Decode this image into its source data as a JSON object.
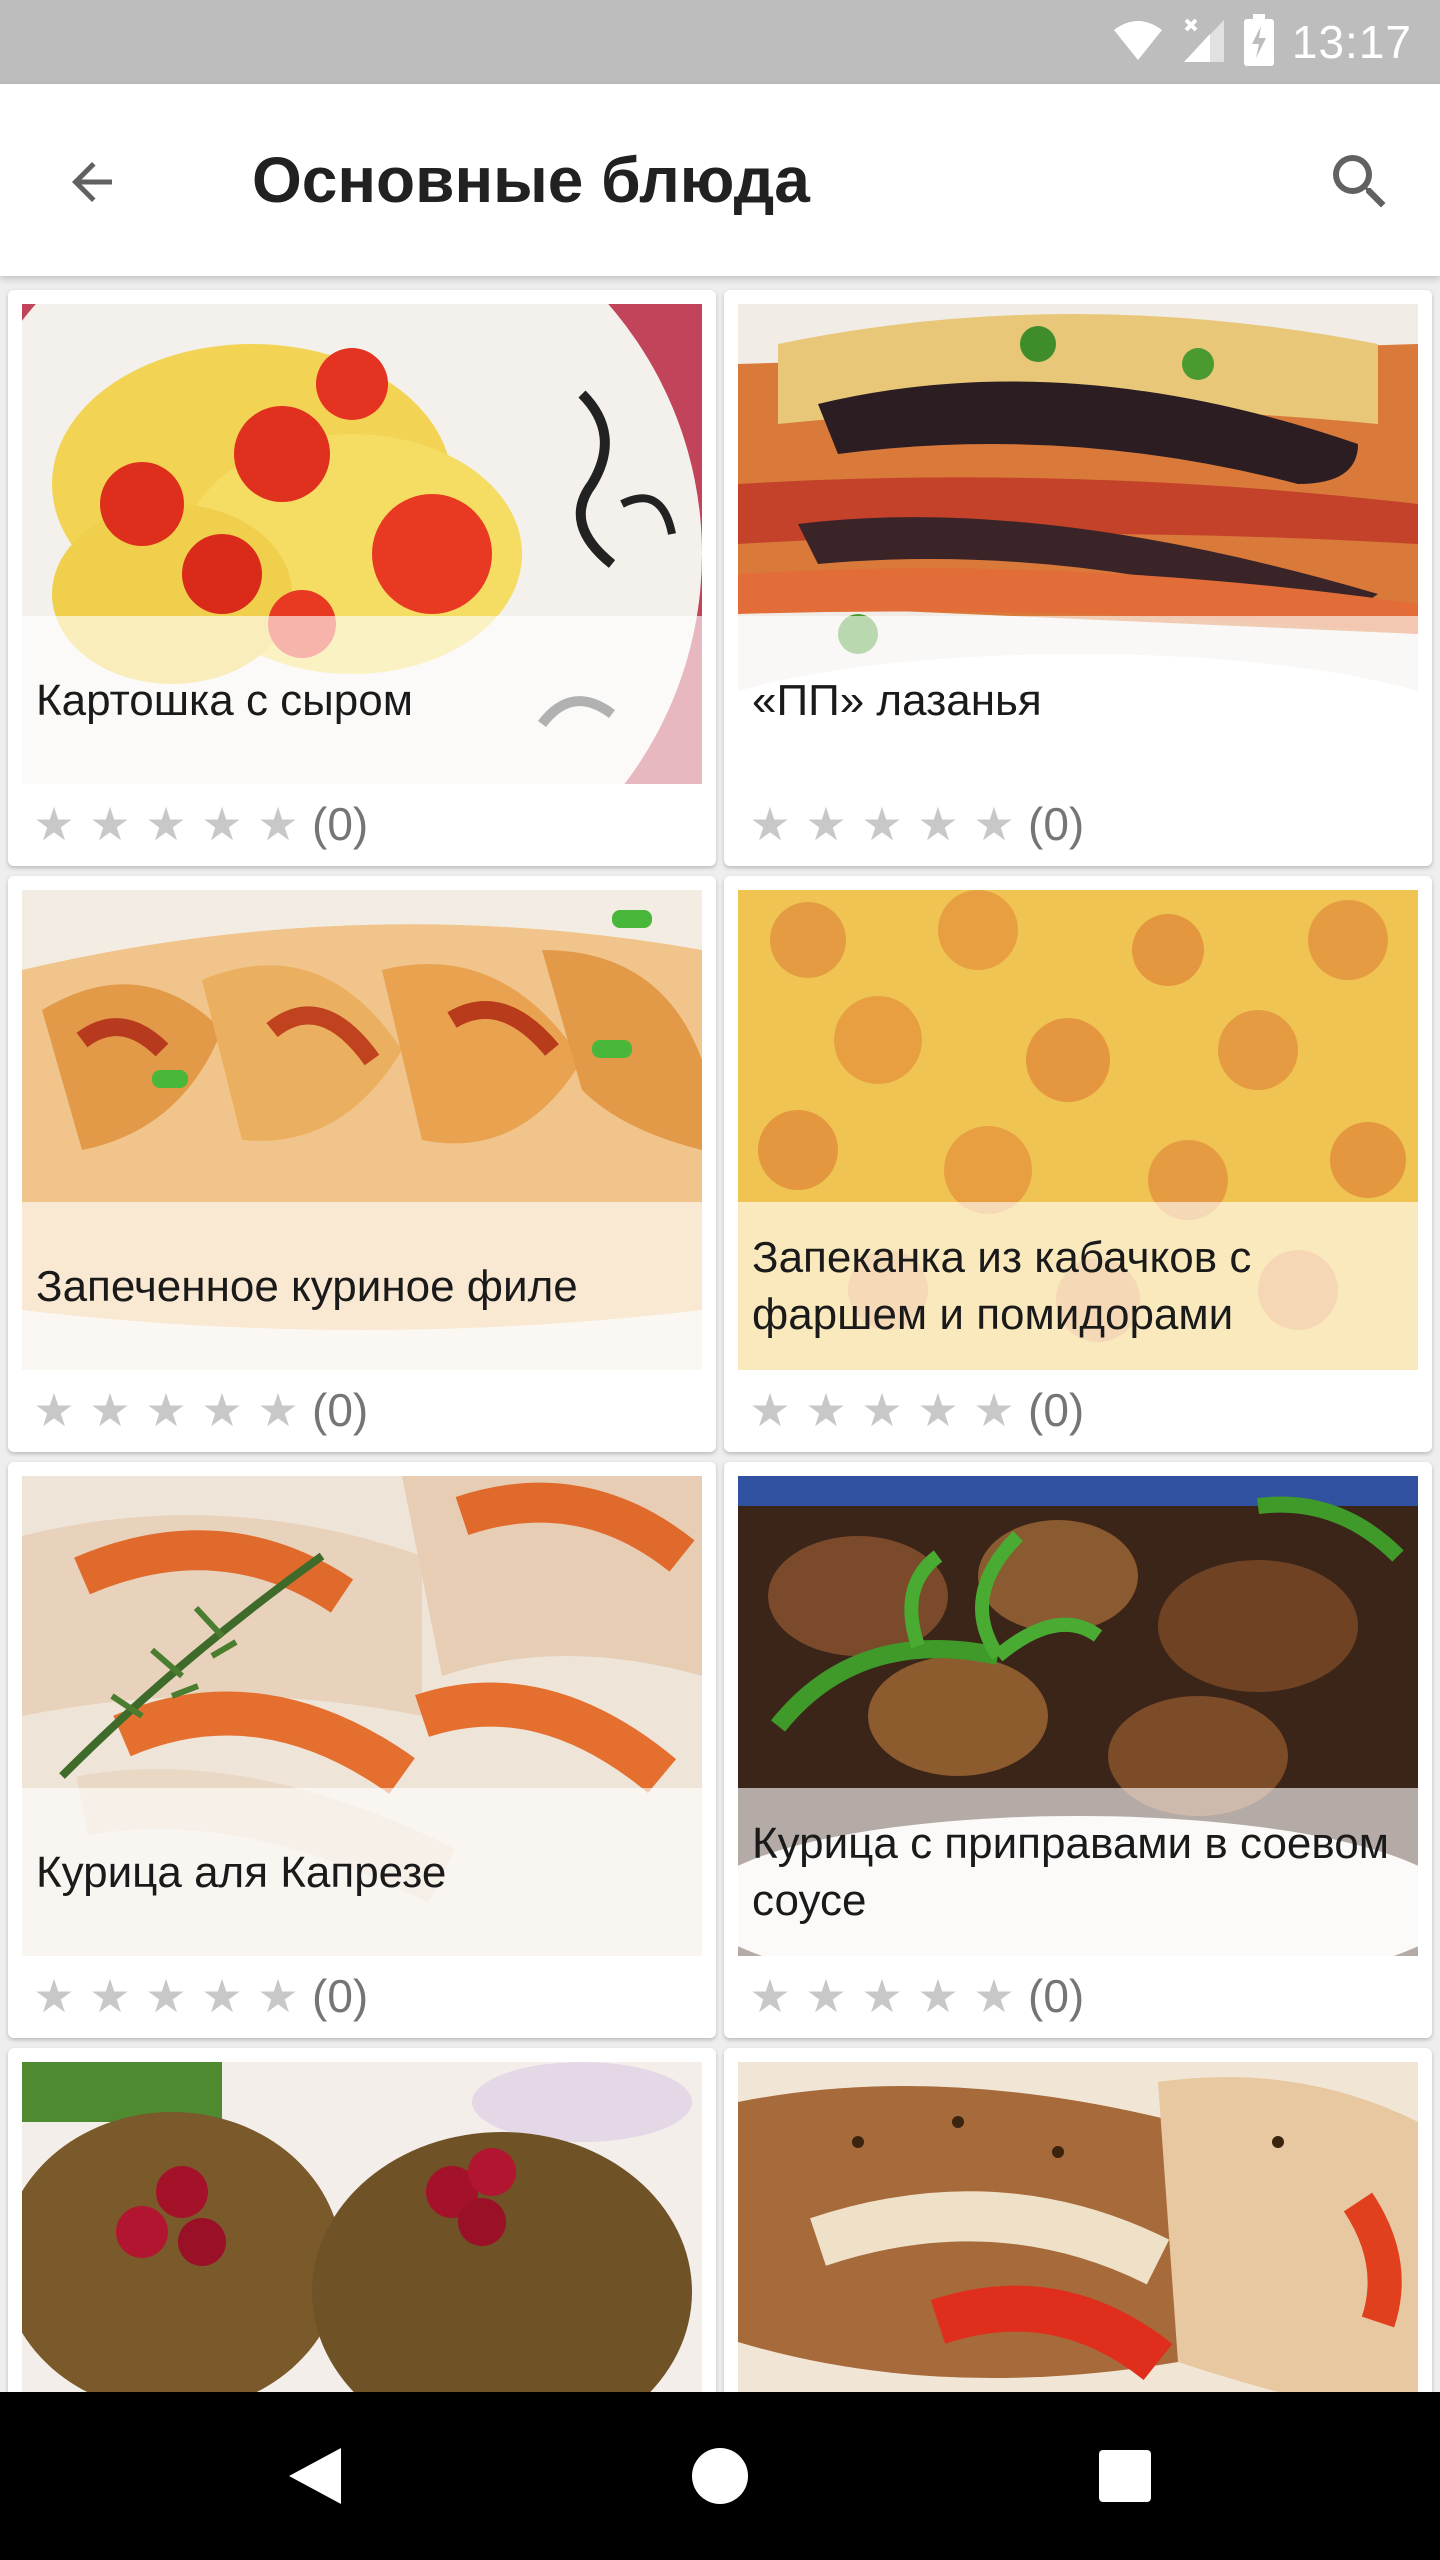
{
  "status_bar": {
    "time": "13:17",
    "icons": [
      "wifi-icon",
      "signal-icon",
      "battery-icon"
    ]
  },
  "app_bar": {
    "title": "Основные блюда",
    "back_icon": "arrow-back-icon",
    "search_icon": "search-icon"
  },
  "colors": {
    "app_bar_bg": "#ffffff",
    "status_bar_bg": "#bdbdbd",
    "star_empty": "#c8c8c8",
    "page_bg": "#eeeeee"
  },
  "recipes": [
    {
      "title": "Картошка с сыром",
      "stars": "★ ★ ★ ★ ★",
      "rating": 0,
      "rating_label": "(0)"
    },
    {
      "title": "«ПП» лазанья",
      "stars": "★ ★ ★ ★ ★",
      "rating": 0,
      "rating_label": "(0)"
    },
    {
      "title": "Запеченное куриное филе",
      "stars": "★ ★ ★ ★ ★",
      "rating": 0,
      "rating_label": "(0)"
    },
    {
      "title": "Запеканка из кабачков с фаршем и помидорами",
      "stars": "★ ★ ★ ★ ★",
      "rating": 0,
      "rating_label": "(0)"
    },
    {
      "title": "Курица аля Капрезе",
      "stars": "★ ★ ★ ★ ★",
      "rating": 0,
      "rating_label": "(0)"
    },
    {
      "title": "Курица с приправами в соевом соусе",
      "stars": "★ ★ ★ ★ ★",
      "rating": 0,
      "rating_label": "(0)"
    },
    {
      "title": "",
      "rating": 0
    },
    {
      "title": "",
      "rating": 0
    }
  ],
  "nav_bar": {
    "icons": [
      "back-triangle-icon",
      "home-circle-icon",
      "recents-square-icon"
    ]
  }
}
